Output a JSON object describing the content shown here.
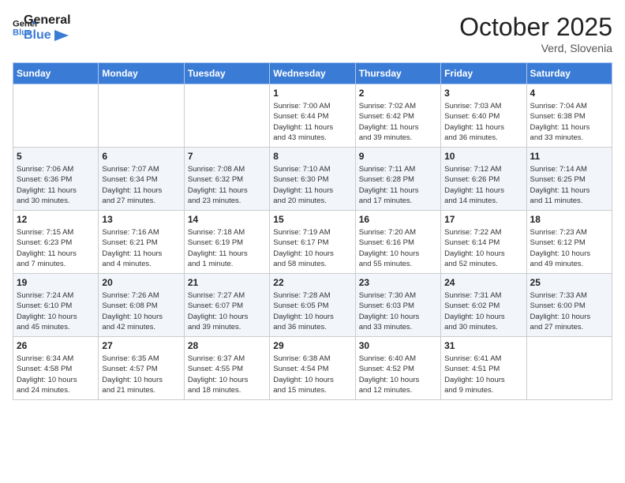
{
  "header": {
    "logo_general": "General",
    "logo_blue": "Blue",
    "month": "October 2025",
    "location": "Verd, Slovenia"
  },
  "weekdays": [
    "Sunday",
    "Monday",
    "Tuesday",
    "Wednesday",
    "Thursday",
    "Friday",
    "Saturday"
  ],
  "weeks": [
    [
      {
        "day": "",
        "info": ""
      },
      {
        "day": "",
        "info": ""
      },
      {
        "day": "",
        "info": ""
      },
      {
        "day": "1",
        "info": "Sunrise: 7:00 AM\nSunset: 6:44 PM\nDaylight: 11 hours\nand 43 minutes."
      },
      {
        "day": "2",
        "info": "Sunrise: 7:02 AM\nSunset: 6:42 PM\nDaylight: 11 hours\nand 39 minutes."
      },
      {
        "day": "3",
        "info": "Sunrise: 7:03 AM\nSunset: 6:40 PM\nDaylight: 11 hours\nand 36 minutes."
      },
      {
        "day": "4",
        "info": "Sunrise: 7:04 AM\nSunset: 6:38 PM\nDaylight: 11 hours\nand 33 minutes."
      }
    ],
    [
      {
        "day": "5",
        "info": "Sunrise: 7:06 AM\nSunset: 6:36 PM\nDaylight: 11 hours\nand 30 minutes."
      },
      {
        "day": "6",
        "info": "Sunrise: 7:07 AM\nSunset: 6:34 PM\nDaylight: 11 hours\nand 27 minutes."
      },
      {
        "day": "7",
        "info": "Sunrise: 7:08 AM\nSunset: 6:32 PM\nDaylight: 11 hours\nand 23 minutes."
      },
      {
        "day": "8",
        "info": "Sunrise: 7:10 AM\nSunset: 6:30 PM\nDaylight: 11 hours\nand 20 minutes."
      },
      {
        "day": "9",
        "info": "Sunrise: 7:11 AM\nSunset: 6:28 PM\nDaylight: 11 hours\nand 17 minutes."
      },
      {
        "day": "10",
        "info": "Sunrise: 7:12 AM\nSunset: 6:26 PM\nDaylight: 11 hours\nand 14 minutes."
      },
      {
        "day": "11",
        "info": "Sunrise: 7:14 AM\nSunset: 6:25 PM\nDaylight: 11 hours\nand 11 minutes."
      }
    ],
    [
      {
        "day": "12",
        "info": "Sunrise: 7:15 AM\nSunset: 6:23 PM\nDaylight: 11 hours\nand 7 minutes."
      },
      {
        "day": "13",
        "info": "Sunrise: 7:16 AM\nSunset: 6:21 PM\nDaylight: 11 hours\nand 4 minutes."
      },
      {
        "day": "14",
        "info": "Sunrise: 7:18 AM\nSunset: 6:19 PM\nDaylight: 11 hours\nand 1 minute."
      },
      {
        "day": "15",
        "info": "Sunrise: 7:19 AM\nSunset: 6:17 PM\nDaylight: 10 hours\nand 58 minutes."
      },
      {
        "day": "16",
        "info": "Sunrise: 7:20 AM\nSunset: 6:16 PM\nDaylight: 10 hours\nand 55 minutes."
      },
      {
        "day": "17",
        "info": "Sunrise: 7:22 AM\nSunset: 6:14 PM\nDaylight: 10 hours\nand 52 minutes."
      },
      {
        "day": "18",
        "info": "Sunrise: 7:23 AM\nSunset: 6:12 PM\nDaylight: 10 hours\nand 49 minutes."
      }
    ],
    [
      {
        "day": "19",
        "info": "Sunrise: 7:24 AM\nSunset: 6:10 PM\nDaylight: 10 hours\nand 45 minutes."
      },
      {
        "day": "20",
        "info": "Sunrise: 7:26 AM\nSunset: 6:08 PM\nDaylight: 10 hours\nand 42 minutes."
      },
      {
        "day": "21",
        "info": "Sunrise: 7:27 AM\nSunset: 6:07 PM\nDaylight: 10 hours\nand 39 minutes."
      },
      {
        "day": "22",
        "info": "Sunrise: 7:28 AM\nSunset: 6:05 PM\nDaylight: 10 hours\nand 36 minutes."
      },
      {
        "day": "23",
        "info": "Sunrise: 7:30 AM\nSunset: 6:03 PM\nDaylight: 10 hours\nand 33 minutes."
      },
      {
        "day": "24",
        "info": "Sunrise: 7:31 AM\nSunset: 6:02 PM\nDaylight: 10 hours\nand 30 minutes."
      },
      {
        "day": "25",
        "info": "Sunrise: 7:33 AM\nSunset: 6:00 PM\nDaylight: 10 hours\nand 27 minutes."
      }
    ],
    [
      {
        "day": "26",
        "info": "Sunrise: 6:34 AM\nSunset: 4:58 PM\nDaylight: 10 hours\nand 24 minutes."
      },
      {
        "day": "27",
        "info": "Sunrise: 6:35 AM\nSunset: 4:57 PM\nDaylight: 10 hours\nand 21 minutes."
      },
      {
        "day": "28",
        "info": "Sunrise: 6:37 AM\nSunset: 4:55 PM\nDaylight: 10 hours\nand 18 minutes."
      },
      {
        "day": "29",
        "info": "Sunrise: 6:38 AM\nSunset: 4:54 PM\nDaylight: 10 hours\nand 15 minutes."
      },
      {
        "day": "30",
        "info": "Sunrise: 6:40 AM\nSunset: 4:52 PM\nDaylight: 10 hours\nand 12 minutes."
      },
      {
        "day": "31",
        "info": "Sunrise: 6:41 AM\nSunset: 4:51 PM\nDaylight: 10 hours\nand 9 minutes."
      },
      {
        "day": "",
        "info": ""
      }
    ]
  ]
}
